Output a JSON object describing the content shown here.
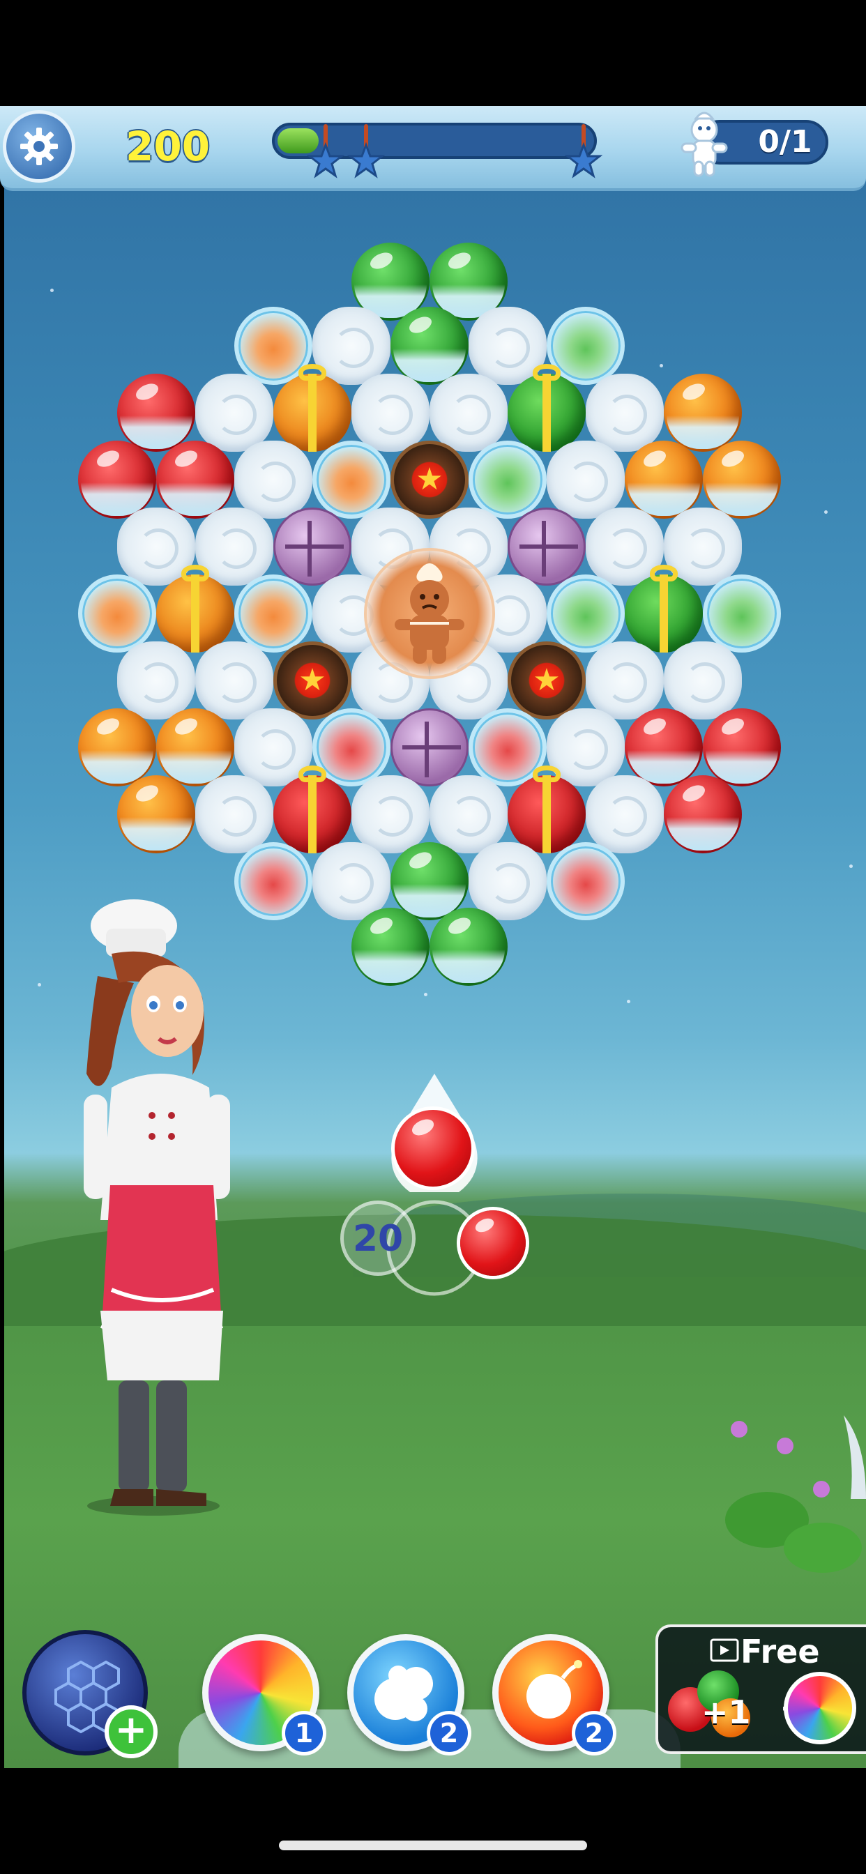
{
  "hud": {
    "score": "200",
    "score_progress": 0.13,
    "goal_text": "0/1",
    "goal_icon": "gingerbread-icon",
    "settings_icon": "gear-icon"
  },
  "shooter": {
    "shots_left": "20",
    "current_color": "red",
    "next_color": "red"
  },
  "boosters": {
    "bubble_shield_icon": "hexagon-shield-icon",
    "rainbow_count": "1",
    "multi_bubble_count": "2",
    "fire_bomb_count": "2",
    "free_label": "Free",
    "free_plus": "+1",
    "free_joiner": "+"
  },
  "colors": {
    "score_yellow": "#fff23a",
    "hud_blue": "#2a5c9a",
    "count_badge_blue": "#1e62d8",
    "plus_green": "#3ec23a"
  }
}
